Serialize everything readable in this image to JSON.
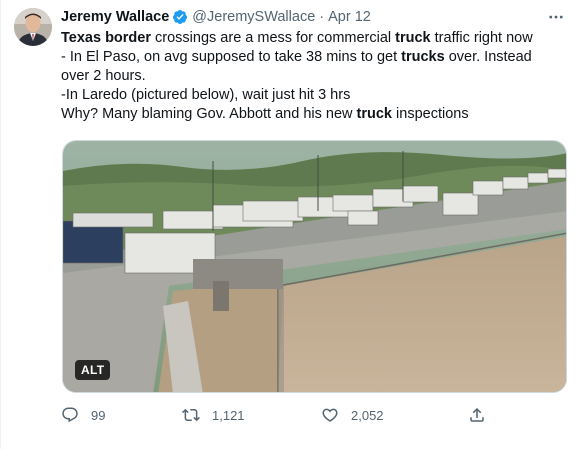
{
  "tweet": {
    "author_name": "Jeremy Wallace",
    "handle": "@JeremySWallace",
    "separator": "·",
    "date": "Apr 12",
    "verified": true,
    "more_icon": "more-horizontal-icon",
    "lines": [
      {
        "segments": [
          {
            "t": "Texas border",
            "bold": true
          },
          {
            "t": " crossings are a mess for commercial ",
            "bold": false
          },
          {
            "t": "truck",
            "bold": true
          },
          {
            "t": " traffic right now",
            "bold": false
          }
        ]
      },
      {
        "segments": [
          {
            "t": "- In El Paso, on avg supposed to take 38 mins to get ",
            "bold": false
          },
          {
            "t": "trucks",
            "bold": true
          },
          {
            "t": " over. Instead",
            "bold": false
          }
        ]
      },
      {
        "segments": [
          {
            "t": "over 2 hours.",
            "bold": false
          }
        ]
      },
      {
        "segments": [
          {
            "t": "-In Laredo (pictured below), wait just hit 3 hrs",
            "bold": false
          }
        ]
      },
      {
        "segments": [
          {
            "t": "Why? Many blaming Gov. Abbott and his new ",
            "bold": false
          },
          {
            "t": "truck",
            "bold": true
          },
          {
            "t": " inspections",
            "bold": false
          }
        ]
      }
    ],
    "media": {
      "alt_label": "ALT"
    },
    "actions": {
      "reply": {
        "icon": "reply-icon",
        "count": "99"
      },
      "retweet": {
        "icon": "retweet-icon",
        "count": "1,121"
      },
      "like": {
        "icon": "like-icon",
        "count": "2,052"
      },
      "share": {
        "icon": "share-icon"
      }
    },
    "colors": {
      "text": "#0f1419",
      "secondary": "#536471",
      "verified": "#1d9bf0",
      "border": "#cfd9de"
    }
  }
}
